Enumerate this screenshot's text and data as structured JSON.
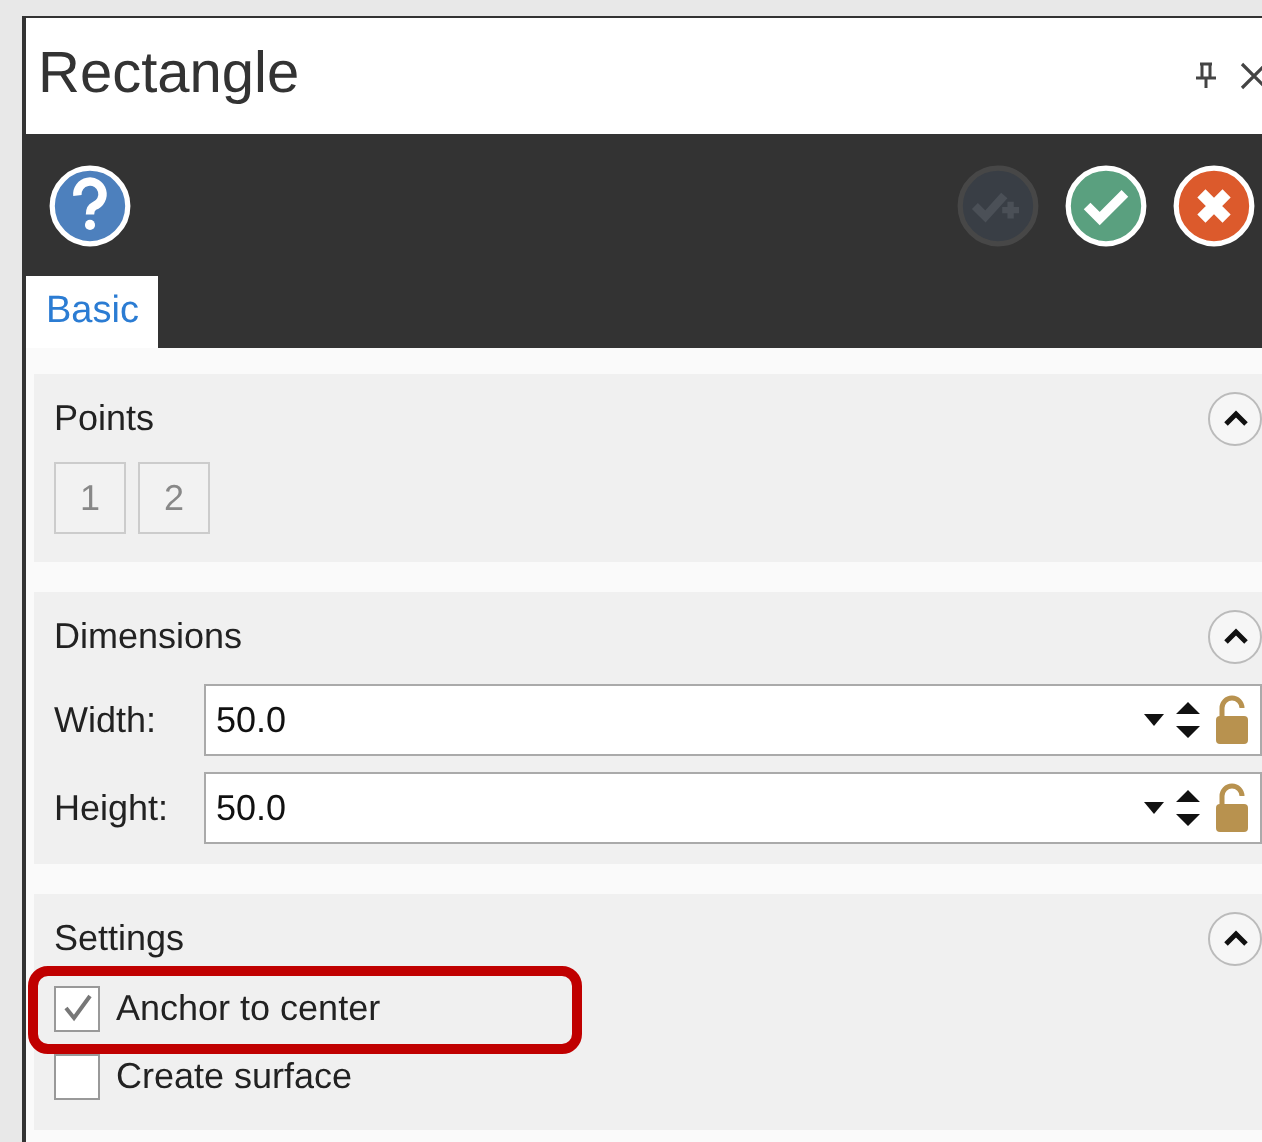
{
  "window": {
    "title": "Rectangle"
  },
  "toolbar": {
    "buttons": [
      {
        "kind": "apply-continue",
        "disabled": true
      },
      {
        "kind": "ok",
        "disabled": false
      },
      {
        "kind": "cancel",
        "disabled": false
      }
    ]
  },
  "tabs": [
    {
      "label": "Basic",
      "selected": true
    }
  ],
  "sections": [
    {
      "kind": "points",
      "title": "Points",
      "expanded": true,
      "points": [
        "1",
        "2"
      ]
    },
    {
      "kind": "dimensions",
      "title": "Dimensions",
      "expanded": true,
      "fields": [
        {
          "label": "Width:",
          "value": "50.0"
        },
        {
          "label": "Height:",
          "value": "50.0"
        }
      ]
    },
    {
      "kind": "settings",
      "title": "Settings",
      "expanded": true,
      "options": [
        {
          "label": "Anchor to center",
          "checked": true,
          "highlighted": true
        },
        {
          "label": "Create surface",
          "checked": false,
          "highlighted": false
        }
      ]
    }
  ]
}
